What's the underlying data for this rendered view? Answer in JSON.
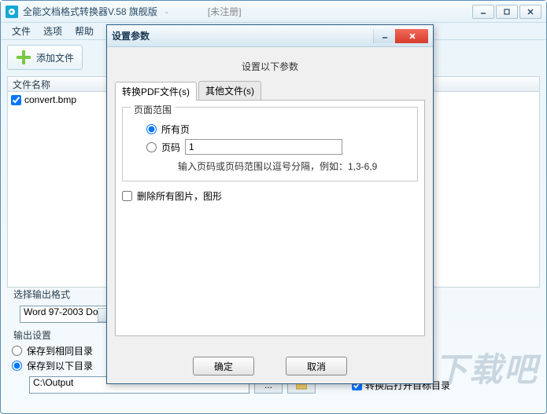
{
  "main": {
    "title": "全能文档格式转换器V.58 旗舰版",
    "status": "[未注册]",
    "menu": {
      "file": "文件",
      "options": "选项",
      "help": "帮助"
    },
    "toolbar": {
      "add_file": "添加文件"
    },
    "columns": {
      "name": "文件名称"
    },
    "files": [
      {
        "checked": true,
        "name": "convert.bmp"
      }
    ],
    "select_format_label": "选择输出格式",
    "select_format_value": "Word 97-2003 Do",
    "output": {
      "label": "输出设置",
      "same_dir": "保存到相同目录",
      "below_dir": "保存到以下目录",
      "path": "C:\\Output",
      "browse_btn": "...",
      "open_after": "转换后打开目标目录",
      "open_after_checked": true,
      "selected": "below"
    },
    "watermark": "下载吧"
  },
  "dialog": {
    "title": "设置参数",
    "subtitle": "设置以下参数",
    "tabs": {
      "pdf": "转换PDF文件(s)",
      "other": "其他文件(s)"
    },
    "page_range": {
      "legend": "页面范围",
      "all": "所有页",
      "pages": "页码",
      "pages_value": "1",
      "hint": "输入页码或页码范围以逗号分隔，例如：1,3-6,9",
      "selected": "all"
    },
    "delete_images": "删除所有图片，图形",
    "delete_images_checked": false,
    "buttons": {
      "ok": "确定",
      "cancel": "取消"
    }
  }
}
